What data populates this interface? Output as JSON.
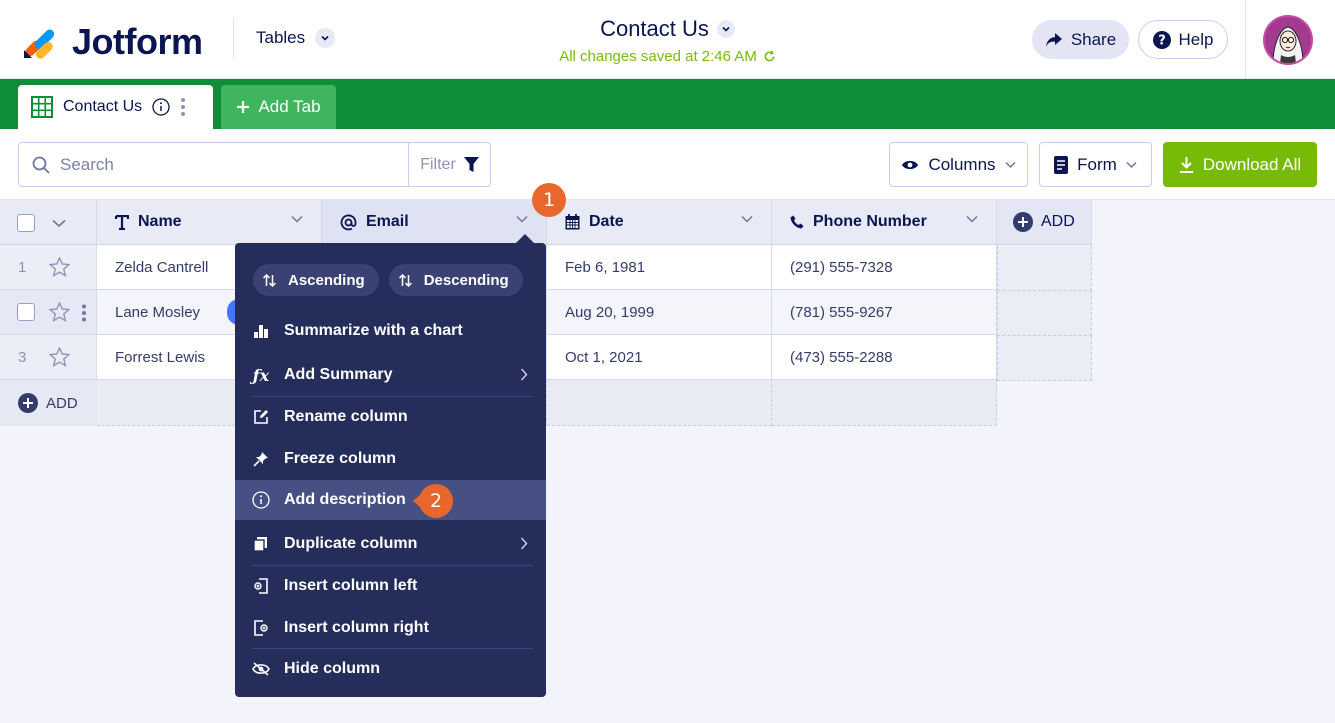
{
  "header": {
    "brand": "Jotform",
    "tables_label": "Tables",
    "doc_title": "Contact Us",
    "saved_status": "All changes saved at 2:46 AM",
    "share_label": "Share",
    "help_label": "Help"
  },
  "tabs": {
    "active_tab": "Contact Us",
    "add_tab_label": "Add Tab"
  },
  "toolbar": {
    "search_placeholder": "Search",
    "filter_label": "Filter",
    "columns_label": "Columns",
    "form_label": "Form",
    "download_label": "Download All"
  },
  "table": {
    "columns": [
      {
        "label": "Name",
        "icon": "text-icon"
      },
      {
        "label": "Email",
        "icon": "at-icon"
      },
      {
        "label": "Date",
        "icon": "calendar-icon"
      },
      {
        "label": "Phone Number",
        "icon": "phone-icon"
      }
    ],
    "add_column_label": "ADD",
    "rows": [
      {
        "num": "1",
        "name": "Zelda Cantrell",
        "date": "Feb 6, 1981",
        "phone": "(291) 555-7328"
      },
      {
        "num": "",
        "name": "Lane Mosley",
        "date": "Aug 20, 1999",
        "phone": "(781) 555-9267"
      },
      {
        "num": "3",
        "name": "Forrest Lewis",
        "date": "Oct 1, 2021",
        "phone": "(473) 555-2288"
      }
    ],
    "add_row_label": "ADD"
  },
  "menu": {
    "ascending": "Ascending",
    "descending": "Descending",
    "items": [
      {
        "label": "Summarize with a chart",
        "icon": "bar-chart-icon"
      },
      {
        "label": "Add Summary",
        "icon": "function-icon"
      },
      {
        "label": "Rename column",
        "icon": "edit-icon"
      },
      {
        "label": "Freeze column",
        "icon": "pin-icon"
      },
      {
        "label": "Add description",
        "icon": "info-icon"
      },
      {
        "label": "Duplicate column",
        "icon": "copy-icon"
      },
      {
        "label": "Insert column left",
        "icon": "insert-left-icon"
      },
      {
        "label": "Insert column right",
        "icon": "insert-right-icon"
      },
      {
        "label": "Hide column",
        "icon": "eye-off-icon"
      }
    ]
  },
  "annotations": {
    "step1": "1",
    "step2": "2"
  },
  "colors": {
    "brand_navy": "#0a1551",
    "tab_bar_green": "#0e8f37",
    "download_green": "#78bb07",
    "menu_bg": "#252d5b",
    "menu_highlight": "#475083",
    "badge_orange": "#e8672c"
  }
}
